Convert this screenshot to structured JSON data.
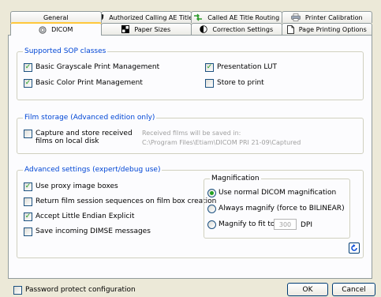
{
  "tabs_row1": [
    {
      "label": "General",
      "icon": "none"
    },
    {
      "label": "Authorized Calling AE Titles",
      "icon": "shield-icon"
    },
    {
      "label": "Called AE Title Routing",
      "icon": "routing-arrows-icon"
    },
    {
      "label": "Printer Calibration",
      "icon": "printer-icon"
    }
  ],
  "tabs_row2": [
    {
      "label": "DICOM",
      "icon": "dicom-gear-icon",
      "active": true
    },
    {
      "label": "Paper Sizes",
      "icon": "grid-icon"
    },
    {
      "label": "Correction Settings",
      "icon": "contrast-icon"
    },
    {
      "label": "Page Printing Options",
      "icon": "page-icon"
    }
  ],
  "sop": {
    "legend": "Supported SOP classes",
    "items": [
      {
        "label": "Basic Grayscale Print Management",
        "checked": true
      },
      {
        "label": "Presentation LUT",
        "checked": true
      },
      {
        "label": "Basic Color Print Management",
        "checked": true
      },
      {
        "label": "Store to print",
        "checked": false
      }
    ]
  },
  "film": {
    "legend": "Film storage (Advanced edition only)",
    "capture_label_line1": "Capture and store received",
    "capture_label_line2": "films on local disk",
    "capture_checked": false,
    "saved_note": "Received films will be saved in:",
    "saved_path": "C:\\Program Files\\Etiam\\DICOM PRI 21-09\\Captured"
  },
  "advanced": {
    "legend": "Advanced settings (expert/debug use)",
    "items": [
      {
        "label": "Use proxy image boxes",
        "checked": true
      },
      {
        "label": "Return film session sequences on film box creation",
        "checked": false
      },
      {
        "label": "Accept Little Endian Explicit",
        "checked": true
      },
      {
        "label": "Save incoming DIMSE messages",
        "checked": false
      }
    ],
    "magnification": {
      "legend": "Magnification",
      "options": [
        {
          "label": "Use normal DICOM magnification",
          "selected": true
        },
        {
          "label": "Always magnify (force to BILINEAR)",
          "selected": false
        },
        {
          "label": "Magnify to fit to",
          "selected": false
        }
      ],
      "dpi_value": "300",
      "dpi_unit": "DPI"
    }
  },
  "footer": {
    "password_label": "Password protect configuration",
    "password_checked": false,
    "ok_label": "OK",
    "cancel_label": "Cancel"
  },
  "colors": {
    "accent": "#0046d5",
    "check": "#21a121",
    "tab_active": "#ffc83c"
  }
}
